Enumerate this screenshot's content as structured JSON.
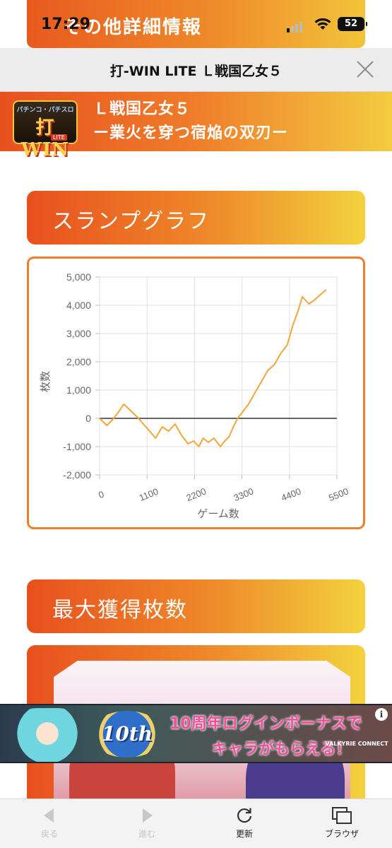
{
  "status_bar": {
    "time": "17:29",
    "battery": "52"
  },
  "background_header": {
    "label": "その他詳細情報"
  },
  "title_bar": {
    "title": "打-WIN LITE Ｌ戦国乙女５"
  },
  "game": {
    "logo_top": "パチンコ・パチスロ",
    "logo_main": "打WIN",
    "logo_sub": "LITE",
    "title_line1": "Ｌ戦国乙女５",
    "title_line2": "ー業火を穿つ宿焔の双刃ー"
  },
  "sections": {
    "slump_graph": "スランプグラフ",
    "max_medals": "最大獲得枚数"
  },
  "chart_data": {
    "type": "line",
    "xlabel": "ゲーム数",
    "ylabel": "枚数",
    "xlim": [
      0,
      5500
    ],
    "ylim": [
      -2000,
      5000
    ],
    "x_ticks": [
      "0",
      "1100",
      "2200",
      "3300",
      "4400",
      "5500"
    ],
    "y_ticks": [
      "5,000",
      "4,000",
      "3,000",
      "2,000",
      "1,000",
      "0",
      "-1,000",
      "-2,000"
    ],
    "grid": true,
    "color": "#f4a43a",
    "series": [
      {
        "x": [
          0,
          170,
          300,
          450,
          560,
          700,
          900,
          1100,
          1300,
          1450,
          1600,
          1750,
          1900,
          2050,
          2180,
          2300,
          2400,
          2520,
          2650,
          2800,
          2900,
          3000,
          3100,
          3200,
          3300,
          3450,
          3600,
          3750,
          3900,
          4050,
          4200,
          4350,
          4480,
          4600,
          4700,
          4850,
          4950,
          5100,
          5250
        ],
        "y": [
          0,
          -250,
          -50,
          250,
          500,
          300,
          0,
          -350,
          -700,
          -300,
          -450,
          -200,
          -600,
          -900,
          -800,
          -1000,
          -700,
          -850,
          -700,
          -1000,
          -800,
          -650,
          -300,
          0,
          200,
          500,
          900,
          1300,
          1700,
          1900,
          2300,
          2600,
          3300,
          3800,
          4300,
          4050,
          4150,
          4350,
          4550
        ]
      }
    ]
  },
  "ad": {
    "badge": "10th",
    "line1": "10周年ログインボーナスで",
    "line2": "キャラがもらえる！",
    "brand": "VALKYRIE CONNECT",
    "info": "i"
  },
  "toolbar": {
    "back": "戻る",
    "forward": "進む",
    "reload": "更新",
    "browser": "ブラウザ"
  }
}
